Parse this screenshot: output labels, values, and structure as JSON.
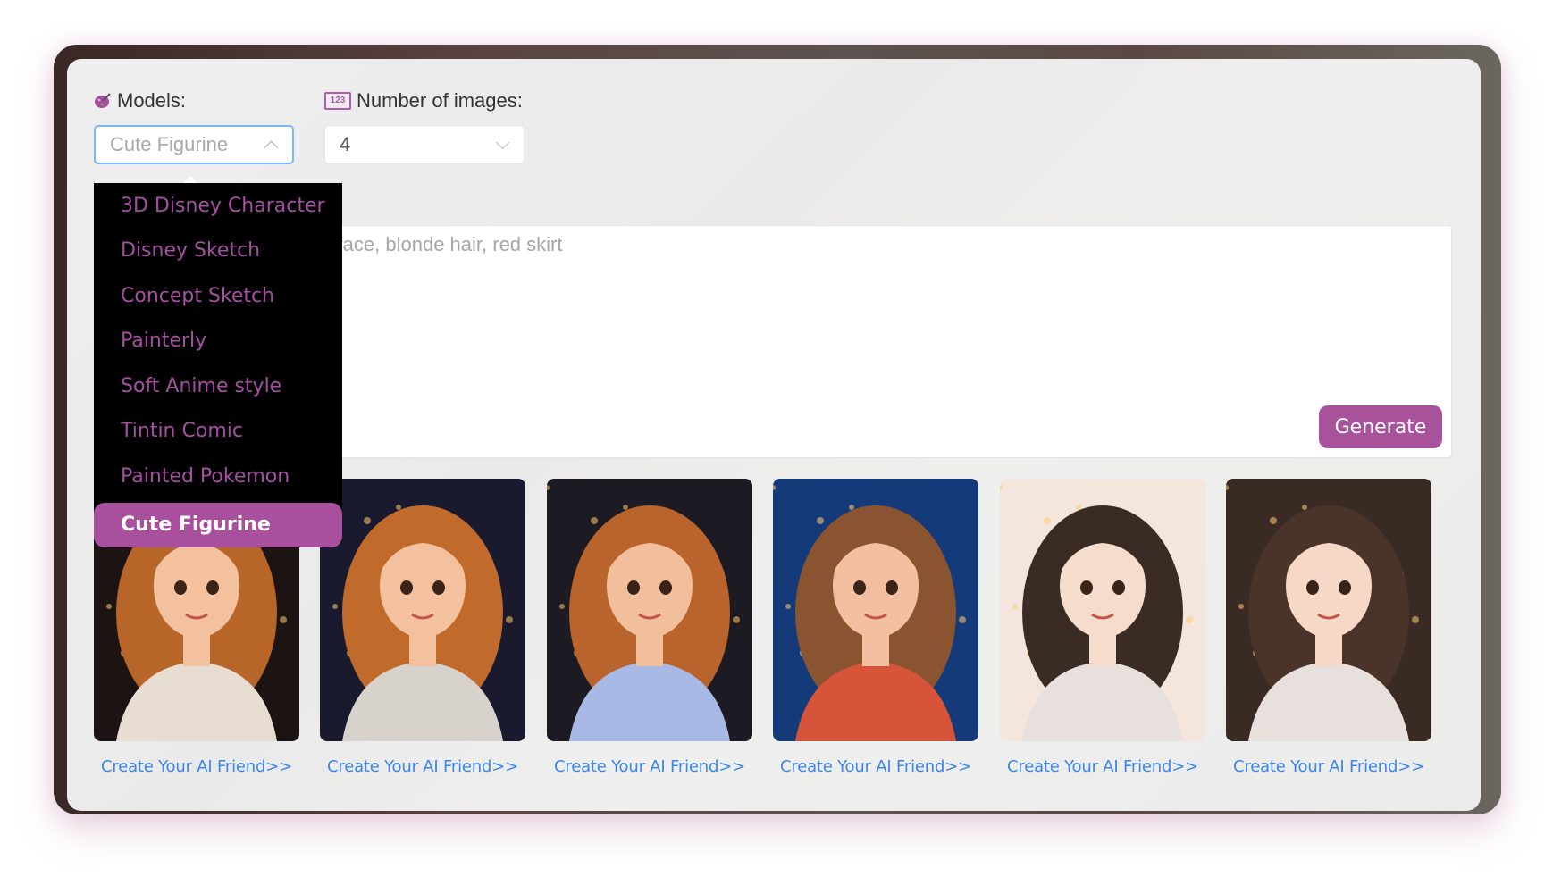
{
  "models": {
    "label": "Models:",
    "icon": "palette-icon",
    "selected": "Cute Figurine",
    "open": true,
    "options": [
      "3D Disney Character",
      "Disney Sketch",
      "Concept Sketch",
      "Painterly",
      "Soft Anime style",
      "Tintin Comic",
      "Painted Pokemon",
      "Cute Figurine"
    ]
  },
  "num_images": {
    "label": "Number of images:",
    "icon": "123-icon",
    "icon_text": "123",
    "value": "4"
  },
  "prompt": {
    "placeholder_visible": ", expressive eyes, perfect face, blonde hair, red skirt"
  },
  "generate_label": "Generate",
  "gallery": [
    {
      "link": "Create Your AI Friend>>",
      "style": "3d-warm-dark",
      "bg": "#1c1412",
      "hair": "#b8652a",
      "shirt": "#e8ddd2",
      "skin": "#f3c19e"
    },
    {
      "link": "Create Your AI Friend>>",
      "style": "3d-warm-night",
      "bg": "#1a1a2e",
      "hair": "#c06b2c",
      "shirt": "#d8d2cc",
      "skin": "#f3c19e"
    },
    {
      "link": "Create Your AI Friend>>",
      "style": "3d-blue-shirt",
      "bg": "#1c1a22",
      "hair": "#b8642c",
      "shirt": "#a9b9e6",
      "skin": "#f2bf9d"
    },
    {
      "link": "Create Your AI Friend>>",
      "style": "3d-red-hoodie",
      "bg": "#153a7a",
      "hair": "#8a5430",
      "shirt": "#d6553a",
      "skin": "#f2c0a0"
    },
    {
      "link": "Create Your AI Friend>>",
      "style": "anime-light",
      "bg": "#f4e6dc",
      "hair": "#3a2b24",
      "shirt": "#e7e0dc",
      "skin": "#f6dccd"
    },
    {
      "link": "Create Your AI Friend>>",
      "style": "anime-warm",
      "bg": "#3a2a24",
      "hair": "#4a3328",
      "shirt": "#e8e0dc",
      "skin": "#f6d8c6"
    }
  ],
  "colors": {
    "accent": "#a8529c",
    "link": "#3b86ee",
    "dropdown_bg": "#000000",
    "dropdown_text": "#a54fa2"
  }
}
